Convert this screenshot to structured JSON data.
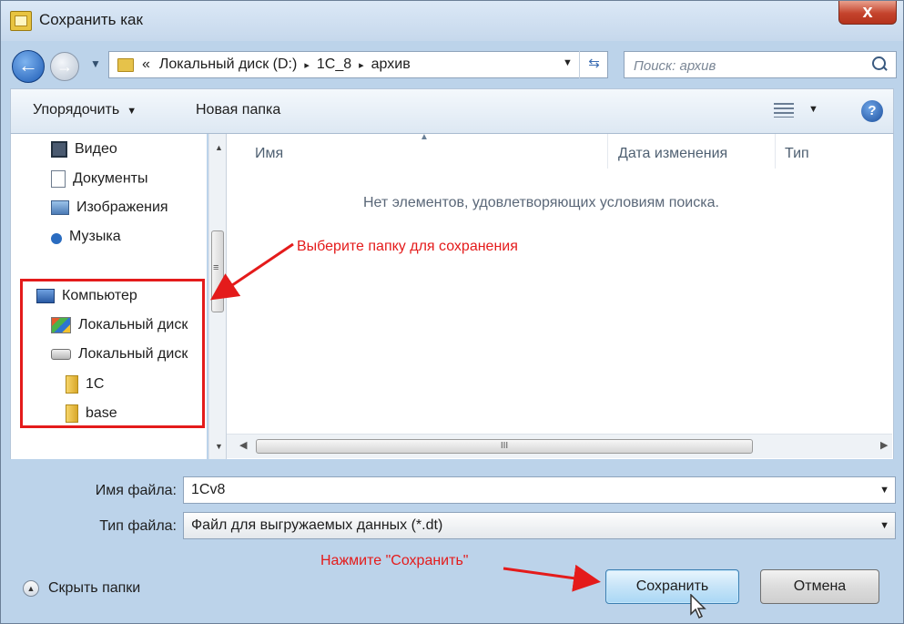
{
  "window": {
    "title": "Сохранить как",
    "close_glyph": "x"
  },
  "navigation": {
    "breadcrumb": {
      "overflow": "«",
      "parts": [
        "Локальный диск (D:)",
        "1С_8",
        "архив"
      ],
      "separator": "▸"
    },
    "search_placeholder": "Поиск: архив"
  },
  "toolbar": {
    "organize_label": "Упорядочить",
    "new_folder_label": "Новая папка",
    "help_glyph": "?"
  },
  "sidebar": {
    "items": [
      {
        "label": "Видео",
        "icon": "video-icon"
      },
      {
        "label": "Документы",
        "icon": "document-icon"
      },
      {
        "label": "Изображения",
        "icon": "picture-icon"
      },
      {
        "label": "Музыка",
        "icon": "music-icon"
      },
      {
        "label": "Компьютер",
        "icon": "computer-icon"
      },
      {
        "label": "Локальный диск",
        "icon": "system-disk-icon"
      },
      {
        "label": "Локальный диск",
        "icon": "disk-icon"
      },
      {
        "label": "1C",
        "icon": "folder-icon"
      },
      {
        "label": "base",
        "icon": "folder-icon"
      }
    ]
  },
  "file_list": {
    "columns": [
      "Имя",
      "Дата изменения",
      "Тип"
    ],
    "empty_message": "Нет элементов, удовлетворяющих условиям поиска.",
    "scroll_grip": "III"
  },
  "form": {
    "filename_label": "Имя файла:",
    "filename_value": "1Cv8",
    "filetype_label": "Тип файла:",
    "filetype_value": "Файл для выгружаемых данных (*.dt)"
  },
  "footer": {
    "hide_folders_label": "Скрыть папки",
    "save_label": "Сохранить",
    "cancel_label": "Отмена"
  },
  "annotations": {
    "select_folder": "Выберите папку для сохранения",
    "press_save": "Нажмите \"Сохранить\"",
    "color": "#e41b1b"
  }
}
